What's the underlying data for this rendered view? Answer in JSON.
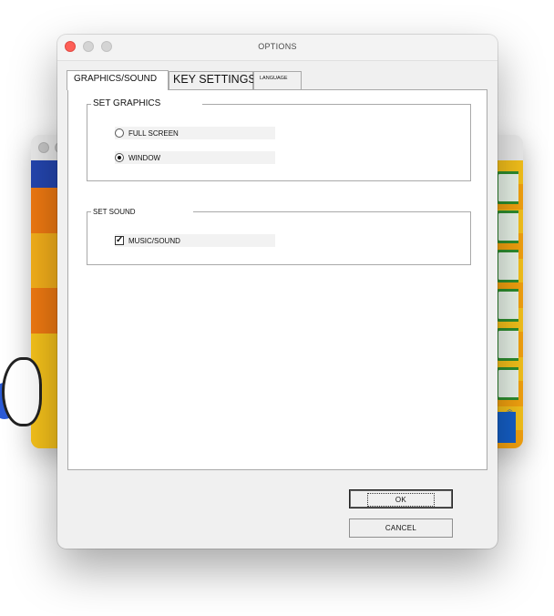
{
  "window": {
    "title": "OPTIONS"
  },
  "tabs": {
    "graphics_sound": "GRAPHICS/SOUND",
    "key_settings": "KEY SETTINGS",
    "language": "LANGUAGE",
    "active": "GRAPHICS/SOUND"
  },
  "graphics": {
    "legend": "SET GRAPHICS",
    "options": [
      {
        "label": "FULL SCREEN",
        "selected": false
      },
      {
        "label": "WINDOW",
        "selected": true
      }
    ]
  },
  "sound": {
    "legend": "SET SOUND",
    "music_sound": {
      "label": "MUSIC/SOUND",
      "checked": true
    }
  },
  "buttons": {
    "ok": "OK",
    "cancel": "CANCEL"
  },
  "colors": {
    "close_light": "#fe5f57",
    "panel_bg": "#ffffff",
    "window_bg": "#f0f0f0"
  },
  "icons": [
    "close-icon",
    "minimize-icon",
    "maximize-icon",
    "checkmark-icon"
  ]
}
